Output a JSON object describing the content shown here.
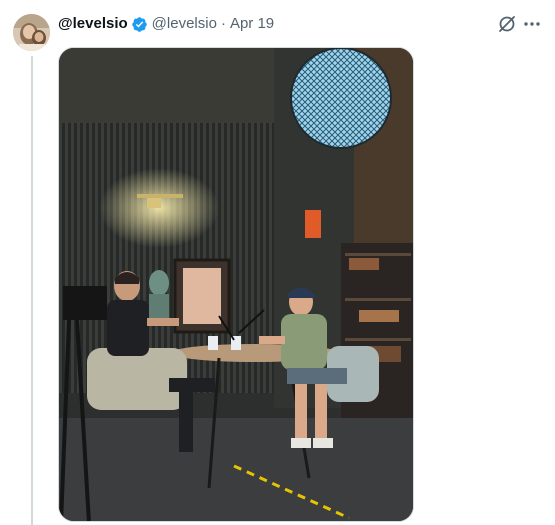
{
  "tweet": {
    "display_name": "@levelsio",
    "handle": "@levelsio",
    "separator": "·",
    "date": "Apr 19",
    "verified": true,
    "verified_color": "#1d9bf0",
    "avatar_icon": "user-avatar",
    "actions": {
      "grok_icon": "grok-icon",
      "more_icon": "more-horizontal-icon"
    },
    "media": {
      "type": "photo",
      "description_icon": "photo-podcast-studio"
    }
  },
  "colors": {
    "text_primary": "#0f1419",
    "text_secondary": "#536471",
    "thread_line": "#cfd9de"
  }
}
